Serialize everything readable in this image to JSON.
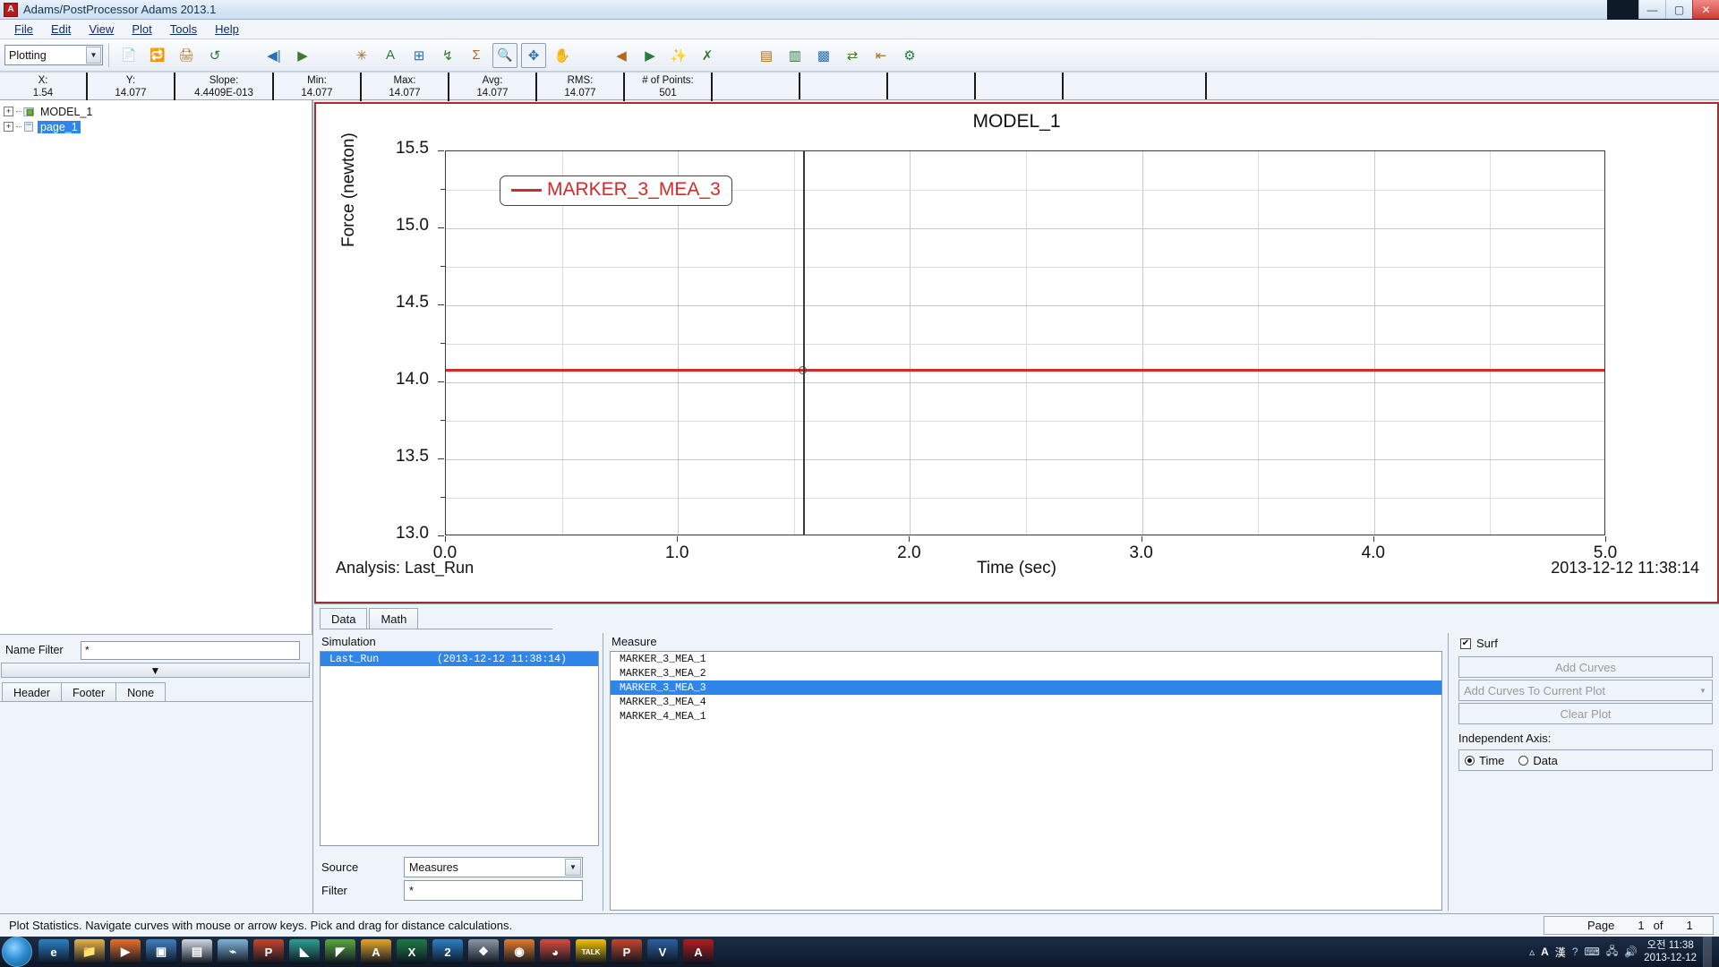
{
  "window": {
    "app_icon": "A",
    "title": "Adams/PostProcessor Adams 2013.1",
    "minimize": "—",
    "maximize": "▢",
    "close": "✕"
  },
  "menu": {
    "items": [
      "File",
      "Edit",
      "View",
      "Plot",
      "Tools",
      "Help"
    ]
  },
  "toolbar": {
    "mode_value": "Plotting",
    "mode_arrow": "▼",
    "buttons": [
      {
        "name": "new-page-icon",
        "glyph": "📄"
      },
      {
        "name": "reload-icon",
        "glyph": "🔁"
      },
      {
        "name": "print-icon",
        "glyph": "🖨"
      },
      {
        "name": "undo-icon",
        "glyph": "↺"
      },
      {
        "name": "first-frame-icon",
        "glyph": "◀|"
      },
      {
        "name": "play-icon",
        "glyph": "▶"
      },
      {
        "name": "clear-plot-icon",
        "glyph": "✳"
      },
      {
        "name": "text-tool-icon",
        "glyph": "A"
      },
      {
        "name": "axis-tool-icon",
        "glyph": "⊞"
      },
      {
        "name": "curve-tool-icon",
        "glyph": "↯"
      },
      {
        "name": "sigma-tool-icon",
        "glyph": "Σ"
      },
      {
        "name": "zoom-select-icon",
        "glyph": "🔍"
      },
      {
        "name": "pan-fit-icon",
        "glyph": "✥"
      },
      {
        "name": "hand-pan-icon",
        "glyph": "✋"
      },
      {
        "name": "prev-page-icon",
        "glyph": "◀"
      },
      {
        "name": "next-page-icon",
        "glyph": "▶"
      },
      {
        "name": "add-page-icon",
        "glyph": "✨"
      },
      {
        "name": "delete-page-icon",
        "glyph": "✗"
      },
      {
        "name": "layout-left-icon",
        "glyph": "▤"
      },
      {
        "name": "layout-top-icon",
        "glyph": "▥"
      },
      {
        "name": "layout-full-icon",
        "glyph": "▩"
      },
      {
        "name": "swap-view-icon",
        "glyph": "⇄"
      },
      {
        "name": "toggle-panel-icon",
        "glyph": "⇤"
      },
      {
        "name": "settings-gear-icon",
        "glyph": "⚙"
      }
    ]
  },
  "statistics": [
    {
      "label": "X:",
      "value": "1.54"
    },
    {
      "label": "Y:",
      "value": "14.077"
    },
    {
      "label": "Slope:",
      "value": "4.4409E-013"
    },
    {
      "label": "Min:",
      "value": "14.077"
    },
    {
      "label": "Max:",
      "value": "14.077"
    },
    {
      "label": "Avg:",
      "value": "14.077"
    },
    {
      "label": "RMS:",
      "value": "14.077"
    },
    {
      "label": "# of Points:",
      "value": "501"
    }
  ],
  "tree": {
    "expander_glyph": "+",
    "nodes": [
      {
        "label": "MODEL_1",
        "selected": false
      },
      {
        "label": "page_1",
        "selected": true
      }
    ]
  },
  "left_panel": {
    "name_filter_label": "Name Filter",
    "name_filter_value": "*",
    "drop_arrow": "▼",
    "hf_tabs": [
      "Header",
      "Footer",
      "None"
    ],
    "hf_active": "None"
  },
  "chart_data": {
    "type": "line",
    "title": "MODEL_1",
    "xlabel": "Time (sec)",
    "ylabel": "Force (newton)",
    "xlim": [
      0.0,
      5.0
    ],
    "ylim": [
      13.0,
      15.5
    ],
    "x_ticks": [
      "0.0",
      "1.0",
      "2.0",
      "3.0",
      "4.0",
      "5.0"
    ],
    "y_ticks": [
      "13.0",
      "13.5",
      "14.0",
      "14.5",
      "15.0",
      "15.5"
    ],
    "x_minor_count": 1,
    "y_minor_count": 1,
    "grid": true,
    "legend": {
      "label": "MARKER_3_MEA_3",
      "color": "#d42a2a",
      "position": "top-left"
    },
    "series": [
      {
        "name": "MARKER_3_MEA_3",
        "color": "#d42a2a",
        "constant_value": 14.077,
        "x": [
          0.0,
          0.5,
          1.0,
          1.5,
          2.0,
          2.5,
          3.0,
          3.5,
          4.0,
          4.5,
          5.0
        ],
        "values": [
          14.077,
          14.077,
          14.077,
          14.077,
          14.077,
          14.077,
          14.077,
          14.077,
          14.077,
          14.077,
          14.077
        ]
      }
    ],
    "cursor": {
      "x": 1.54,
      "y": 14.077
    },
    "footer_left": "Analysis:  Last_Run",
    "footer_right": "2013-12-12 11:38:14"
  },
  "bottom_panel": {
    "tabs": [
      {
        "label": "Data",
        "active": true
      },
      {
        "label": "Math",
        "active": false
      }
    ],
    "simulation_label": "Simulation",
    "simulation_rows": [
      {
        "name": "Last_Run",
        "timestamp": "(2013-12-12 11:38:14)",
        "selected": true
      }
    ],
    "measure_label": "Measure",
    "measure_rows": [
      {
        "label": "MARKER_3_MEA_1",
        "selected": false
      },
      {
        "label": "MARKER_3_MEA_2",
        "selected": false
      },
      {
        "label": "MARKER_3_MEA_3",
        "selected": true
      },
      {
        "label": "MARKER_3_MEA_4",
        "selected": false
      },
      {
        "label": "MARKER_4_MEA_1",
        "selected": false
      }
    ],
    "source_label": "Source",
    "source_value": "Measures",
    "source_arrow": "▼",
    "filter_label": "Filter",
    "filter_value": "*"
  },
  "right_panel": {
    "surf_label": "Surf",
    "surf_checked": "✔",
    "add_curves_label": "Add Curves",
    "add_curves_mode": "Add Curves To Current Plot",
    "add_curves_arrow": "▼",
    "clear_plot_label": "Clear Plot",
    "independent_axis_label": "Independent Axis:",
    "axis_options": [
      {
        "label": "Time",
        "selected": true
      },
      {
        "label": "Data",
        "selected": false
      }
    ]
  },
  "status_bar": {
    "message": "Plot Statistics.  Navigate curves with mouse or arrow keys.  Pick and drag for distance calculations.",
    "page_label": "Page",
    "page_current": "1",
    "page_of": "of",
    "page_total": "1"
  },
  "taskbar": {
    "items": [
      {
        "name": "taskbar-internet-explorer",
        "glyph": "e",
        "color": "#2b7fc4"
      },
      {
        "name": "taskbar-file-explorer",
        "glyph": "📁",
        "color": "#e8b44a"
      },
      {
        "name": "taskbar-media-player",
        "glyph": "▶",
        "color": "#e8702a"
      },
      {
        "name": "taskbar-window-app",
        "glyph": "▣",
        "color": "#3f7fbf"
      },
      {
        "name": "taskbar-notepad",
        "glyph": "▤",
        "color": "#cfd8e2"
      },
      {
        "name": "taskbar-editor-app",
        "glyph": "⌁",
        "color": "#7fb3d5"
      },
      {
        "name": "taskbar-powerpoint",
        "glyph": "P",
        "color": "#c3452a"
      },
      {
        "name": "taskbar-teal-app",
        "glyph": "◣",
        "color": "#2e9e8f"
      },
      {
        "name": "taskbar-green-app",
        "glyph": "◤",
        "color": "#5aa83c"
      },
      {
        "name": "taskbar-autodesk-app",
        "glyph": "A",
        "color": "#e8a52a"
      },
      {
        "name": "taskbar-excel",
        "glyph": "X",
        "color": "#1f7a44"
      },
      {
        "name": "taskbar-blue-doc",
        "glyph": "2",
        "color": "#2b7fc4"
      },
      {
        "name": "taskbar-gray-app",
        "glyph": "❖",
        "color": "#8c97a3"
      },
      {
        "name": "taskbar-orange-app",
        "glyph": "◉",
        "color": "#e07b2a"
      },
      {
        "name": "taskbar-chrome",
        "glyph": "◕",
        "color": "#d94b3e"
      },
      {
        "name": "taskbar-kakaotalk",
        "glyph": "TALK",
        "color": "#f2c200"
      },
      {
        "name": "taskbar-powerpoint-2",
        "glyph": "P",
        "color": "#c3452a"
      },
      {
        "name": "taskbar-visio",
        "glyph": "V",
        "color": "#2b5f9e"
      },
      {
        "name": "taskbar-adams",
        "glyph": "A",
        "color": "#b21c1c"
      }
    ],
    "tray": {
      "ime_lang": "A",
      "ime_hanja": "漢",
      "help_glyph": "?",
      "keyboard_glyph": "⌨",
      "network_glyph": "🖧",
      "volume_glyph": "🔊",
      "clock_time": "오전 11:38",
      "clock_date": "2013-12-12"
    }
  }
}
